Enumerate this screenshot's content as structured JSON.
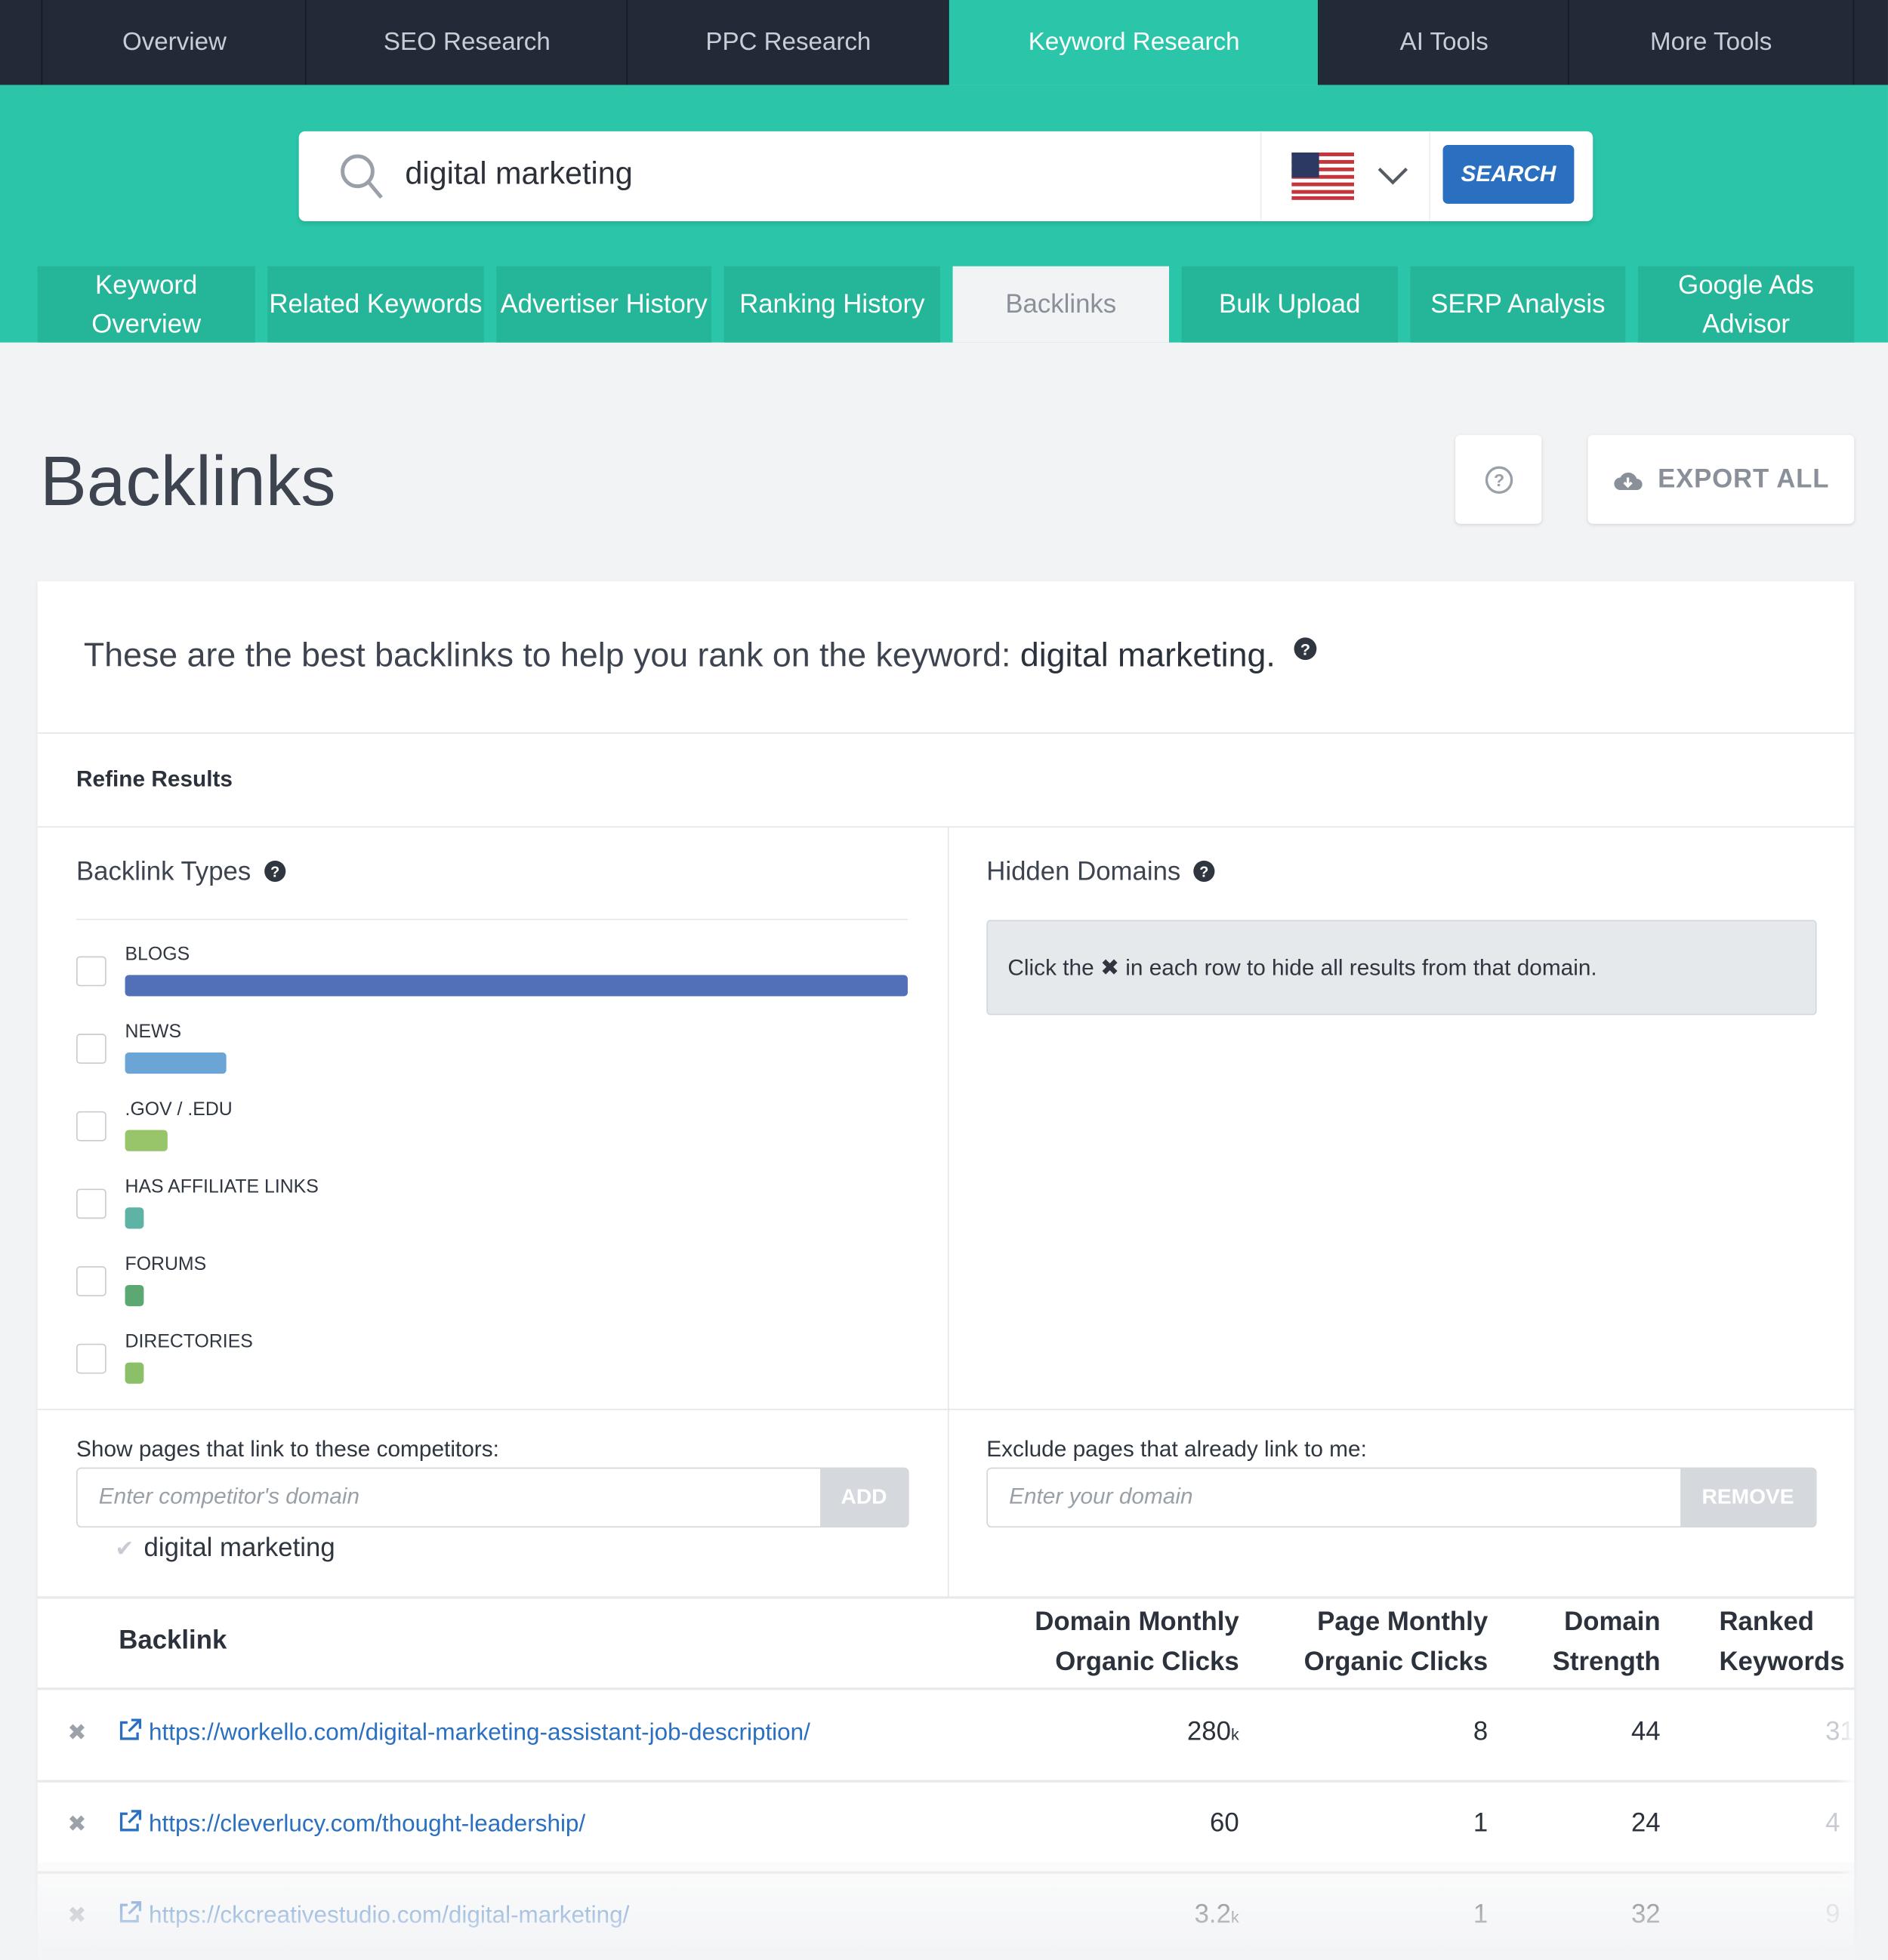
{
  "top_nav": {
    "items": [
      "Overview",
      "SEO Research",
      "PPC Research",
      "Keyword Research",
      "AI Tools",
      "More Tools"
    ],
    "active": "Keyword Research"
  },
  "search": {
    "value": "digital marketing",
    "country_flag": "us-flag-icon",
    "button": "SEARCH"
  },
  "sub_tabs": {
    "items": [
      "Keyword Overview",
      "Related Keywords",
      "Advertiser History",
      "Ranking History",
      "Backlinks",
      "Bulk Upload",
      "SERP Analysis",
      "Google Ads Advisor"
    ],
    "active": "Backlinks"
  },
  "page": {
    "title": "Backlinks",
    "export_label": "EXPORT ALL"
  },
  "intro": {
    "text": "These are the best backlinks to help you rank on the keyword: ",
    "keyword": "digital marketing."
  },
  "refine": {
    "title": "Refine Results",
    "backlink_types": {
      "title": "Backlink Types",
      "items": [
        {
          "label": "BLOGS",
          "level": 1.0,
          "color": "#5170b8"
        },
        {
          "label": "NEWS",
          "level": 0.13,
          "color": "#6aa5d6"
        },
        {
          "label": ".GOV / .EDU",
          "level": 0.055,
          "color": "#98c46a"
        },
        {
          "label": "HAS AFFILIATE LINKS",
          "level": 0.024,
          "color": "#5fb3a4"
        },
        {
          "label": "FORUMS",
          "level": 0.024,
          "color": "#5ba873"
        },
        {
          "label": "DIRECTORIES",
          "level": 0.024,
          "color": "#8cc068"
        }
      ]
    },
    "hidden_domains": {
      "title": "Hidden Domains",
      "hint_before": "Click the ",
      "hint_after": " in each row to hide all results from that domain."
    },
    "competitors": {
      "label": "Show pages that link to these competitors:",
      "placeholder": "Enter competitor's domain",
      "button": "ADD",
      "items": [
        "digital marketing"
      ]
    },
    "exclude": {
      "label": "Exclude pages that already link to me:",
      "placeholder": "Enter your domain",
      "button": "REMOVE"
    }
  },
  "table": {
    "columns": [
      "Backlink",
      "Domain Monthly Organic Clicks",
      "Page Monthly Organic Clicks",
      "Domain Strength",
      "Ranked Keywords"
    ],
    "col_lines": [
      [
        "Domain Monthly",
        "Organic Clicks"
      ],
      [
        "Page Monthly",
        "Organic Clicks"
      ],
      [
        "Domain",
        "Strength"
      ],
      [
        "Ranked",
        "Keywords"
      ]
    ],
    "rows": [
      {
        "url": "https://workello.com/digital-marketing-assistant-job-description/",
        "domain_clicks": "280",
        "domain_clicks_unit": "k",
        "page_clicks": "8",
        "strength": "44",
        "ranked": "31"
      },
      {
        "url": "https://cleverlucy.com/thought-leadership/",
        "domain_clicks": "60",
        "domain_clicks_unit": "",
        "page_clicks": "1",
        "strength": "24",
        "ranked": "4"
      },
      {
        "url": "https://ckcreativestudio.com/digital-marketing/",
        "domain_clicks": "3.2",
        "domain_clicks_unit": "k",
        "page_clicks": "1",
        "strength": "32",
        "ranked": "9"
      }
    ]
  }
}
